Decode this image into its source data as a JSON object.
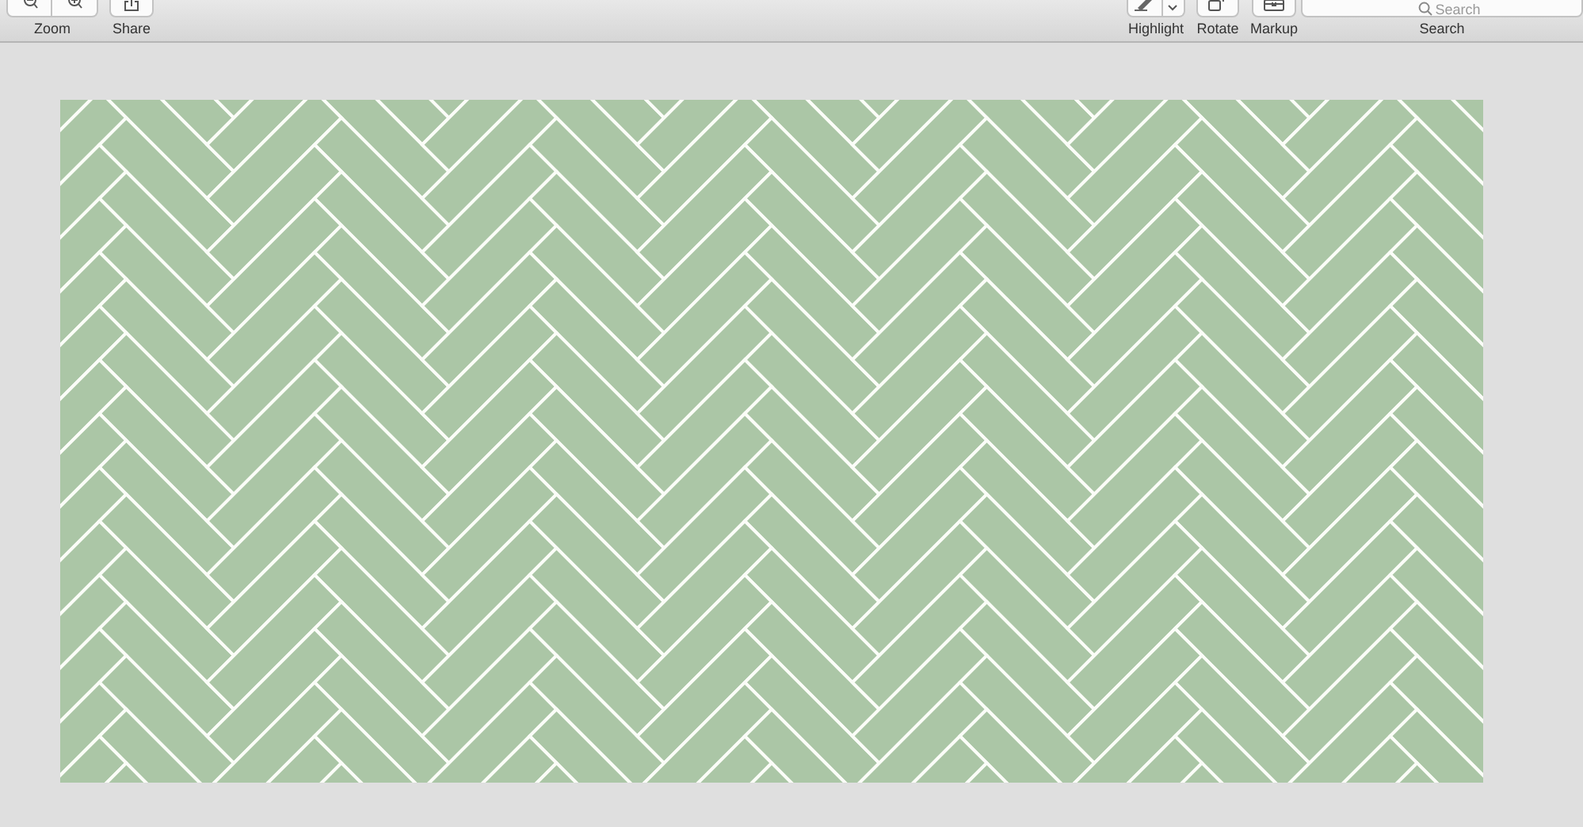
{
  "toolbar": {
    "left": [
      {
        "kind": "zoom",
        "label": "Zoom"
      },
      {
        "kind": "share",
        "label": "Share"
      }
    ],
    "right": [
      {
        "kind": "highlight",
        "label": "Highlight"
      },
      {
        "kind": "rotate",
        "label": "Rotate"
      },
      {
        "kind": "markup",
        "label": "Markup"
      }
    ],
    "search": {
      "placeholder": "Search",
      "label": "Search"
    }
  }
}
